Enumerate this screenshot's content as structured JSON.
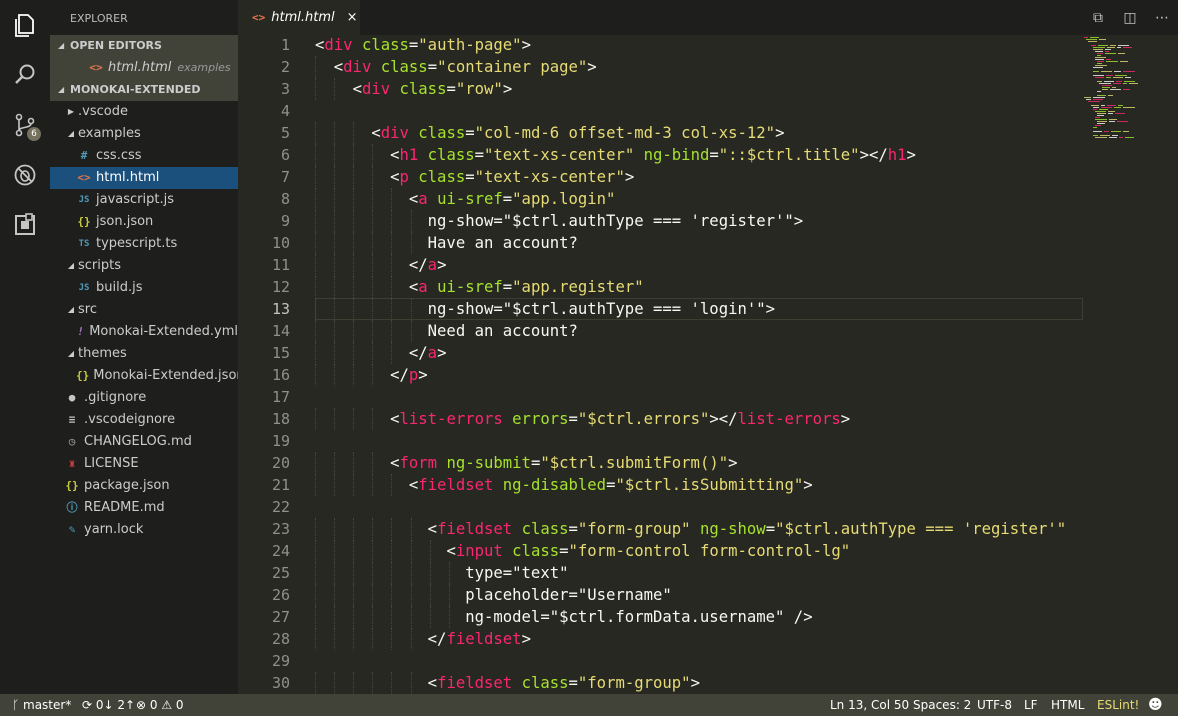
{
  "sidebar": {
    "title": "EXPLORER",
    "open_editors_header": "OPEN EDITORS",
    "open_editor": {
      "name": "html.html",
      "folder": "examples"
    },
    "project_header": "MONOKAI-EXTENDED",
    "tree": [
      {
        "label": ".vscode",
        "type": "folder",
        "open": false
      },
      {
        "label": "examples",
        "type": "folder",
        "open": true
      },
      {
        "label": "css.css",
        "icon": "#"
      },
      {
        "label": "html.html",
        "icon": "<>"
      },
      {
        "label": "javascript.js",
        "icon": "JS"
      },
      {
        "label": "json.json",
        "icon": "{}"
      },
      {
        "label": "typescript.ts",
        "icon": "TS"
      },
      {
        "label": "scripts",
        "type": "folder",
        "open": true
      },
      {
        "label": "build.js",
        "icon": "JS"
      },
      {
        "label": "src",
        "type": "folder",
        "open": true
      },
      {
        "label": "Monokai-Extended.yml",
        "icon": "!"
      },
      {
        "label": "themes",
        "type": "folder",
        "open": true
      },
      {
        "label": "Monokai-Extended.json",
        "icon": "{}"
      },
      {
        "label": ".gitignore",
        "icon": "git"
      },
      {
        "label": ".vscodeignore",
        "icon": "≡"
      },
      {
        "label": "CHANGELOG.md",
        "icon": "clock"
      },
      {
        "label": "LICENSE",
        "icon": "license"
      },
      {
        "label": "package.json",
        "icon": "{}"
      },
      {
        "label": "README.md",
        "icon": "i"
      },
      {
        "label": "yarn.lock",
        "icon": "yarn"
      }
    ]
  },
  "activity": {
    "scm_badge": "6"
  },
  "tab": {
    "label": "html.html",
    "close": "×"
  },
  "editor": {
    "line_numbers": [
      "1",
      "2",
      "3",
      "4",
      "5",
      "6",
      "7",
      "8",
      "9",
      "10",
      "11",
      "12",
      "13",
      "14",
      "15",
      "16",
      "17",
      "18",
      "19",
      "20",
      "21",
      "22",
      "23",
      "24",
      "25",
      "26",
      "27",
      "28",
      "29",
      "30"
    ],
    "lines": [
      "<div class=\"auth-page\">",
      "  <div class=\"container page\">",
      "    <div class=\"row\">",
      "",
      "      <div class=\"col-md-6 offset-md-3 col-xs-12\">",
      "        <h1 class=\"text-xs-center\" ng-bind=\"::$ctrl.title\"></h1>",
      "        <p class=\"text-xs-center\">",
      "          <a ui-sref=\"app.login\"",
      "            ng-show=\"$ctrl.authType === 'register'\">",
      "            Have an account?",
      "          </a>",
      "          <a ui-sref=\"app.register\"",
      "            ng-show=\"$ctrl.authType === 'login'\">",
      "            Need an account?",
      "          </a>",
      "        </p>",
      "",
      "        <list-errors errors=\"$ctrl.errors\"></list-errors>",
      "",
      "        <form ng-submit=\"$ctrl.submitForm()\">",
      "          <fieldset ng-disabled=\"$ctrl.isSubmitting\">",
      "",
      "            <fieldset class=\"form-group\" ng-show=\"$ctrl.authType === 'register'\"",
      "              <input class=\"form-control form-control-lg\"",
      "                type=\"text\"",
      "                placeholder=\"Username\"",
      "                ng-model=\"$ctrl.formData.username\" />",
      "            </fieldset>",
      "",
      "            <fieldset class=\"form-group\">"
    ],
    "active_line": 13
  },
  "status": {
    "branch": "master*",
    "sync": "0↓ 2↑",
    "errors": "0",
    "warnings": "0",
    "position": "Ln 13, Col 50",
    "spaces": "Spaces: 2",
    "encoding": "UTF-8",
    "eol": "LF",
    "language": "HTML",
    "linter": "ESLint!"
  },
  "colors": {
    "tag": "#f92672",
    "attribute": "#a6e22e",
    "string": "#e6db74",
    "text": "#f8f8f2",
    "background": "#272822",
    "sidebar": "#1e1f1c",
    "selection": "#1b4f7c",
    "statusbar": "#414339"
  }
}
